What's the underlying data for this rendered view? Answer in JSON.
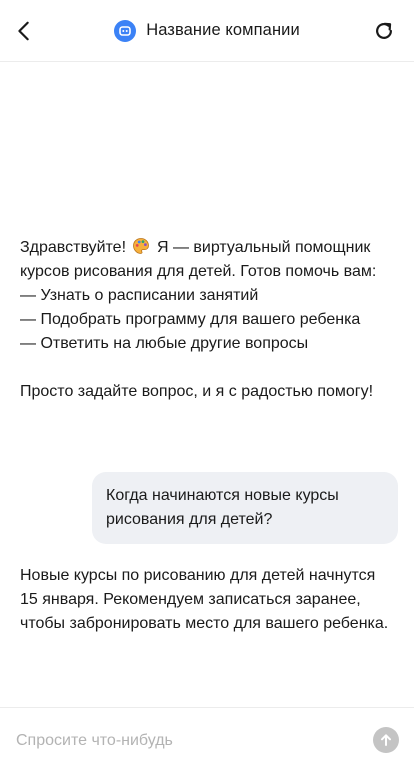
{
  "header": {
    "title": "Название компании",
    "back_icon": "chevron-left-icon",
    "refresh_icon": "refresh-icon",
    "avatar_icon": "robot-icon",
    "accent_color": "#3b82f6"
  },
  "messages": [
    {
      "role": "bot",
      "greeting": "Здравствуйте!",
      "emoji_icon": "palette-icon",
      "text": "Я — виртуальный помощник курсов рисования для детей. Готов помочь вам:\n— Узнать о расписании занятий\n— Подобрать программу для вашего ребенка\n— Ответить на любые другие вопросы\n\nПросто задайте вопрос, и я с радостью помогу!"
    },
    {
      "role": "user",
      "text": "Когда начинаются новые курсы рисования для детей?"
    },
    {
      "role": "bot",
      "text": "Новые курсы по рисованию для детей начнутся 15 января. Рекомендуем записаться заранее, чтобы забронировать место для вашего ребенка."
    }
  ],
  "composer": {
    "placeholder": "Спросите что-нибудь",
    "value": "",
    "send_icon": "arrow-up-icon"
  }
}
